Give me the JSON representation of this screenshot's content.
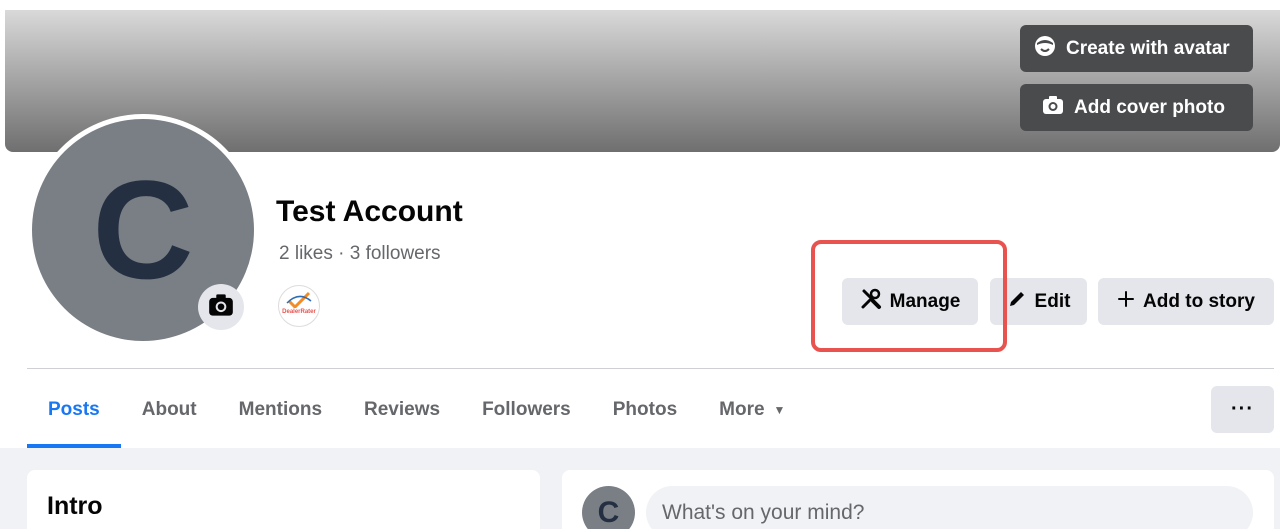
{
  "cover": {
    "create_avatar_label": "Create with avatar",
    "add_cover_label": "Add cover photo"
  },
  "profile": {
    "initial": "C",
    "name": "Test Account",
    "stats": "2 likes · 3 followers",
    "badge_icon": "dealerrater-icon"
  },
  "actions": {
    "manage_label": "Manage",
    "edit_label": "Edit",
    "add_story_label": "Add to story"
  },
  "tabs": [
    {
      "label": "Posts",
      "active": true
    },
    {
      "label": "About"
    },
    {
      "label": "Mentions"
    },
    {
      "label": "Reviews"
    },
    {
      "label": "Followers"
    },
    {
      "label": "Photos"
    },
    {
      "label": "More"
    }
  ],
  "more_menu_label": "···",
  "intro": {
    "title": "Intro"
  },
  "composer": {
    "initial": "C",
    "placeholder": "What's on your mind?"
  },
  "colors": {
    "accent": "#1877f2",
    "highlight": "#e8534f",
    "button_bg": "#e4e6eb"
  }
}
